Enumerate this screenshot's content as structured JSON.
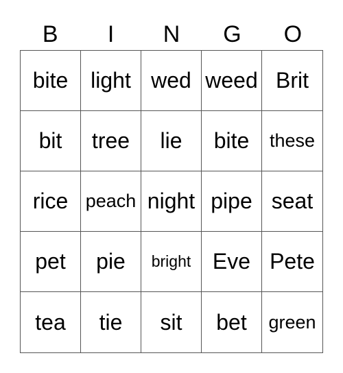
{
  "header": [
    "B",
    "I",
    "N",
    "G",
    "O"
  ],
  "cells": [
    "bite",
    "light",
    "wed",
    "weed",
    "Brit",
    "bit",
    "tree",
    "lie",
    "bite",
    "these",
    "rice",
    "peach",
    "night",
    "pipe",
    "seat",
    "pet",
    "pie",
    "bright",
    "Eve",
    "Pete",
    "tea",
    "tie",
    "sit",
    "bet",
    "green"
  ]
}
